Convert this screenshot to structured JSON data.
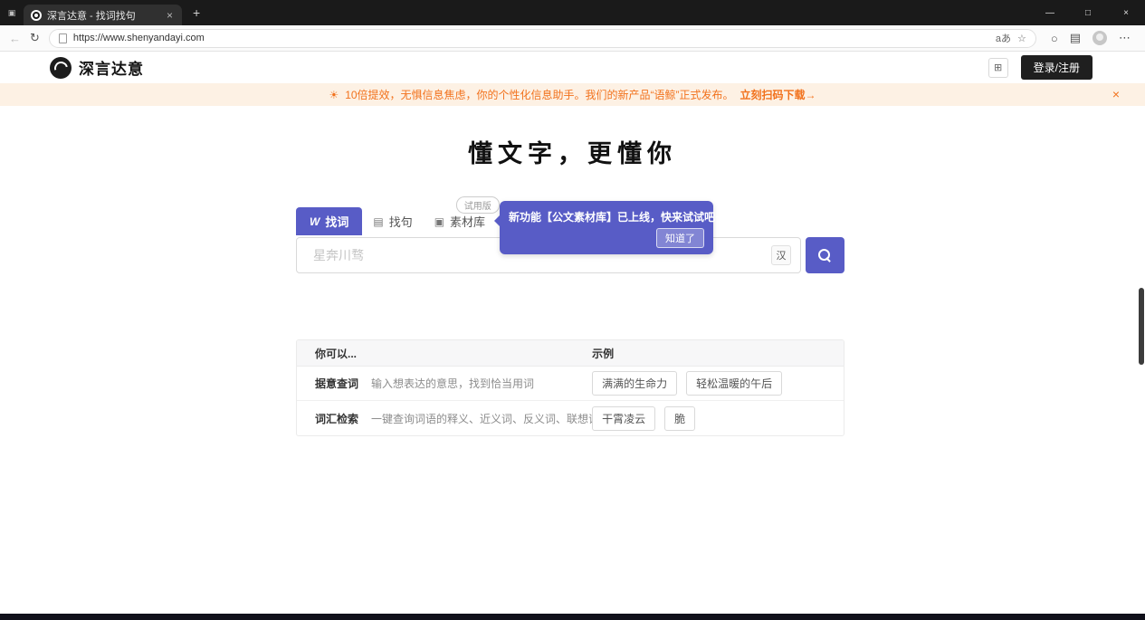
{
  "browser": {
    "tab_title": "深言达意 - 找词找句",
    "url": "https://www.shenyandayi.com"
  },
  "icons": {
    "tab_actions": "▣",
    "tab_close": "×",
    "new_tab": "+",
    "minimize": "—",
    "maximize": "□",
    "close": "×",
    "back": "←",
    "refresh": "↻",
    "translate": "aあ",
    "favorite": "☆",
    "extension": "○",
    "collections": "▤",
    "more": "⋯",
    "banner_icon": "☀",
    "panel": "⊞",
    "ime": "汉",
    "word_tab": "W",
    "sentence_tab": "▤",
    "library_tab": "▣"
  },
  "header": {
    "logo_text": "深言达意",
    "login_label": "登录/注册"
  },
  "banner": {
    "text": "10倍提效，无惧信息焦虑，你的个性化信息助手。我们的新产品“语鲸”正式发布。",
    "link_label": "立刻扫码下载→",
    "close": "×"
  },
  "hero": {
    "title": "懂文字，更懂你"
  },
  "tabs": [
    {
      "label": "找词",
      "active": true
    },
    {
      "label": "找句",
      "active": false
    },
    {
      "label": "素材库",
      "active": false,
      "badge": "试用版"
    }
  ],
  "tooltip": {
    "text": "新功能【公文素材库】已上线，快来试试吧~",
    "button_label": "知道了"
  },
  "search": {
    "placeholder": "星奔川骛"
  },
  "table": {
    "headers": [
      "你可以...",
      "示例"
    ],
    "rows": [
      {
        "title": "据意查词",
        "desc": "输入想表达的意思，找到恰当用词",
        "examples": [
          "满满的生命力",
          "轻松温暖的午后"
        ]
      },
      {
        "title": "词汇检索",
        "desc": "一键查询词语的释义、近义词、反义词、联想词等",
        "examples": [
          "干霄凌云",
          "脆"
        ]
      }
    ]
  }
}
